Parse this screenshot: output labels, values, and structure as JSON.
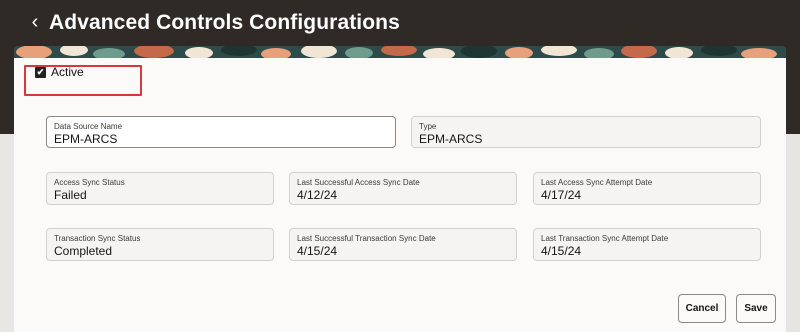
{
  "header": {
    "back_icon": "chevron-left-icon",
    "back_glyph": "‹",
    "title": "Advanced Controls Configurations"
  },
  "colors": {
    "header_bg": "#302a27",
    "highlight_border": "#d9373b"
  },
  "form": {
    "active": {
      "label": "Active",
      "checked": true,
      "check_glyph": "✔"
    },
    "fields": {
      "data_source_name": {
        "label": "Data Source Name",
        "value": "EPM-ARCS",
        "editable": true
      },
      "type": {
        "label": "Type",
        "value": "EPM-ARCS"
      },
      "access_sync_status": {
        "label": "Access Sync Status",
        "value": "Failed"
      },
      "last_successful_access_sync_date": {
        "label": "Last Successful Access Sync Date",
        "value": "4/12/24"
      },
      "last_access_sync_attempt_date": {
        "label": "Last Access Sync Attempt Date",
        "value": "4/17/24"
      },
      "transaction_sync_status": {
        "label": "Transaction Sync Status",
        "value": "Completed"
      },
      "last_successful_transaction_sync_date": {
        "label": "Last Successful Transaction Sync Date",
        "value": "4/15/24"
      },
      "last_transaction_sync_attempt_date": {
        "label": "Last Transaction Sync Attempt Date",
        "value": "4/15/24"
      }
    }
  },
  "actions": {
    "cancel": "Cancel",
    "save": "Save"
  }
}
